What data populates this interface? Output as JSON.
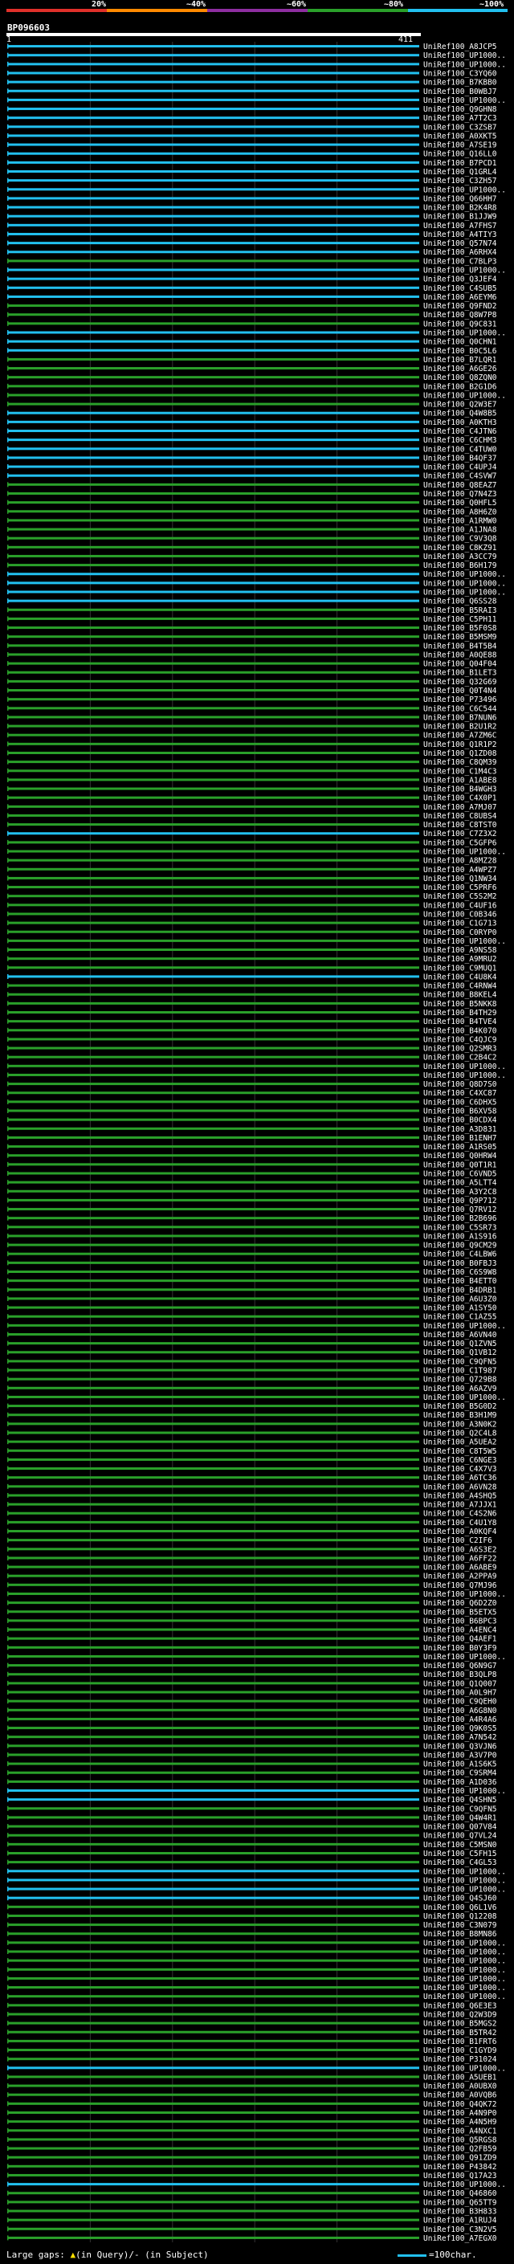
{
  "query_id": "BP096603",
  "query_length_start": "1",
  "query_length_end": "411",
  "scale_ticks": [
    "20%",
    "~40%",
    "~60%",
    "~80%",
    "~100%"
  ],
  "scale_colors": [
    "#e0302a",
    "#ff8a00",
    "#8e2ea0",
    "#2aa02a",
    "#22c0ef"
  ],
  "legend": {
    "left_text": "Large gaps: ",
    "gap_in_query": "(in Query)/",
    "gap_in_subject": "- (in Subject)",
    "right_text": "=100char."
  },
  "chart_data": {
    "type": "table",
    "title": "",
    "series_colors": {
      "high": "#22c0ef",
      "mid": "#2aa02a"
    },
    "rows": [
      {
        "id": "UniRef100_A8JCP5",
        "identity": "high"
      },
      {
        "id": "UniRef100_UP1000..",
        "identity": "high"
      },
      {
        "id": "UniRef100_UP1000..",
        "identity": "high"
      },
      {
        "id": "UniRef100_C3YQ60",
        "identity": "high"
      },
      {
        "id": "UniRef100_B7KBB0",
        "identity": "high"
      },
      {
        "id": "UniRef100_B0WBJ7",
        "identity": "high"
      },
      {
        "id": "UniRef100_UP1000..",
        "identity": "high"
      },
      {
        "id": "UniRef100_Q9GHN8",
        "identity": "high"
      },
      {
        "id": "UniRef100_A7T2C3",
        "identity": "high"
      },
      {
        "id": "UniRef100_C3ZSB7",
        "identity": "high"
      },
      {
        "id": "UniRef100_A0XKT5",
        "identity": "high"
      },
      {
        "id": "UniRef100_A7SE19",
        "identity": "high"
      },
      {
        "id": "UniRef100_Q16LL0",
        "identity": "high"
      },
      {
        "id": "UniRef100_B7PCD1",
        "identity": "high"
      },
      {
        "id": "UniRef100_Q1GRL4",
        "identity": "high"
      },
      {
        "id": "UniRef100_C3ZH57",
        "identity": "high"
      },
      {
        "id": "UniRef100_UP1000..",
        "identity": "high"
      },
      {
        "id": "UniRef100_Q66HH7",
        "identity": "high"
      },
      {
        "id": "UniRef100_B2K4R8",
        "identity": "high"
      },
      {
        "id": "UniRef100_B1JJW9",
        "identity": "high"
      },
      {
        "id": "UniRef100_A7FHS7",
        "identity": "high"
      },
      {
        "id": "UniRef100_A4TIY3",
        "identity": "high"
      },
      {
        "id": "UniRef100_Q57N74",
        "identity": "high"
      },
      {
        "id": "UniRef100_A6RHX4",
        "identity": "high"
      },
      {
        "id": "UniRef100_C7BLP3",
        "identity": "mid"
      },
      {
        "id": "UniRef100_UP1000..",
        "identity": "high"
      },
      {
        "id": "UniRef100_Q3JEF4",
        "identity": "high"
      },
      {
        "id": "UniRef100_C4SUB5",
        "identity": "high"
      },
      {
        "id": "UniRef100_A6EYM6",
        "identity": "high"
      },
      {
        "id": "UniRef100_Q9FND2",
        "identity": "mid"
      },
      {
        "id": "UniRef100_Q8W7P8",
        "identity": "mid"
      },
      {
        "id": "UniRef100_Q9C831",
        "identity": "mid"
      },
      {
        "id": "UniRef100_UP1000..",
        "identity": "high"
      },
      {
        "id": "UniRef100_Q0CHN1",
        "identity": "high"
      },
      {
        "id": "UniRef100_B0C5L6",
        "identity": "high"
      },
      {
        "id": "UniRef100_B7LQR1",
        "identity": "mid"
      },
      {
        "id": "UniRef100_A6GE26",
        "identity": "mid"
      },
      {
        "id": "UniRef100_Q8ZQN0",
        "identity": "mid"
      },
      {
        "id": "UniRef100_B2G1D6",
        "identity": "mid"
      },
      {
        "id": "UniRef100_UP1000..",
        "identity": "mid"
      },
      {
        "id": "UniRef100_Q2W3E7",
        "identity": "mid"
      },
      {
        "id": "UniRef100_Q4W8B5",
        "identity": "high"
      },
      {
        "id": "UniRef100_A0KTH3",
        "identity": "high"
      },
      {
        "id": "UniRef100_C4JTN6",
        "identity": "high"
      },
      {
        "id": "UniRef100_C6CHM3",
        "identity": "high"
      },
      {
        "id": "UniRef100_C4TUW0",
        "identity": "high"
      },
      {
        "id": "UniRef100_B4QF37",
        "identity": "high"
      },
      {
        "id": "UniRef100_C4UPJ4",
        "identity": "high"
      },
      {
        "id": "UniRef100_C4SVW7",
        "identity": "high"
      },
      {
        "id": "UniRef100_Q8EAZ7",
        "identity": "mid"
      },
      {
        "id": "UniRef100_Q7N4Z3",
        "identity": "mid"
      },
      {
        "id": "UniRef100_Q0HFL5",
        "identity": "mid"
      },
      {
        "id": "UniRef100_A8H6Z0",
        "identity": "mid"
      },
      {
        "id": "UniRef100_A1RMW0",
        "identity": "mid"
      },
      {
        "id": "UniRef100_A1JNA8",
        "identity": "mid"
      },
      {
        "id": "UniRef100_C9V3Q8",
        "identity": "mid"
      },
      {
        "id": "UniRef100_C8KZ91",
        "identity": "mid"
      },
      {
        "id": "UniRef100_A3CC79",
        "identity": "mid"
      },
      {
        "id": "UniRef100_B6H179",
        "identity": "mid"
      },
      {
        "id": "UniRef100_UP1000..",
        "identity": "high"
      },
      {
        "id": "UniRef100_UP1000..",
        "identity": "high"
      },
      {
        "id": "UniRef100_UP1000..",
        "identity": "high"
      },
      {
        "id": "UniRef100_Q6SS28",
        "identity": "high"
      },
      {
        "id": "UniRef100_B5RAI3",
        "identity": "mid"
      },
      {
        "id": "UniRef100_C5PH11",
        "identity": "mid"
      },
      {
        "id": "UniRef100_B5F0S8",
        "identity": "mid"
      },
      {
        "id": "UniRef100_B5MSM9",
        "identity": "mid"
      },
      {
        "id": "UniRef100_B4T5B4",
        "identity": "mid"
      },
      {
        "id": "UniRef100_A0QE88",
        "identity": "mid"
      },
      {
        "id": "UniRef100_Q04F04",
        "identity": "mid"
      },
      {
        "id": "UniRef100_B1LET3",
        "identity": "mid"
      },
      {
        "id": "UniRef100_Q32G69",
        "identity": "mid"
      },
      {
        "id": "UniRef100_Q0T4N4",
        "identity": "mid"
      },
      {
        "id": "UniRef100_P73496",
        "identity": "mid"
      },
      {
        "id": "UniRef100_C6C544",
        "identity": "mid"
      },
      {
        "id": "UniRef100_B7NUN6",
        "identity": "mid"
      },
      {
        "id": "UniRef100_B2U1R2",
        "identity": "mid"
      },
      {
        "id": "UniRef100_A7ZM6C",
        "identity": "mid"
      },
      {
        "id": "UniRef100_Q1R1P2",
        "identity": "mid"
      },
      {
        "id": "UniRef100_Q1ZD08",
        "identity": "mid"
      },
      {
        "id": "UniRef100_C8QM39",
        "identity": "mid"
      },
      {
        "id": "UniRef100_C1M4C3",
        "identity": "mid"
      },
      {
        "id": "UniRef100_A1ABE8",
        "identity": "mid"
      },
      {
        "id": "UniRef100_B4WGH3",
        "identity": "mid"
      },
      {
        "id": "UniRef100_C4X0P1",
        "identity": "mid"
      },
      {
        "id": "UniRef100_A7MJ07",
        "identity": "mid"
      },
      {
        "id": "UniRef100_C8UBS4",
        "identity": "mid"
      },
      {
        "id": "UniRef100_C8TST0",
        "identity": "mid"
      },
      {
        "id": "UniRef100_C7Z3X2",
        "identity": "high"
      },
      {
        "id": "UniRef100_C5GFP6",
        "identity": "mid"
      },
      {
        "id": "UniRef100_UP1000..",
        "identity": "mid"
      },
      {
        "id": "UniRef100_A8MZ28",
        "identity": "mid"
      },
      {
        "id": "UniRef100_A4WPZ7",
        "identity": "mid"
      },
      {
        "id": "UniRef100_Q1NW34",
        "identity": "mid"
      },
      {
        "id": "UniRef100_C5PRF6",
        "identity": "mid"
      },
      {
        "id": "UniRef100_C5S2M2",
        "identity": "mid"
      },
      {
        "id": "UniRef100_C4UF16",
        "identity": "mid"
      },
      {
        "id": "UniRef100_C0B346",
        "identity": "mid"
      },
      {
        "id": "UniRef100_C1G713",
        "identity": "mid"
      },
      {
        "id": "UniRef100_C0RYP0",
        "identity": "mid"
      },
      {
        "id": "UniRef100_UP1000..",
        "identity": "mid"
      },
      {
        "id": "UniRef100_A9NS58",
        "identity": "mid"
      },
      {
        "id": "UniRef100_A9MRU2",
        "identity": "mid"
      },
      {
        "id": "UniRef100_C9MUQ1",
        "identity": "mid"
      },
      {
        "id": "UniRef100_C4U8K4",
        "identity": "high"
      },
      {
        "id": "UniRef100_C4RNW4",
        "identity": "mid"
      },
      {
        "id": "UniRef100_B8KEL4",
        "identity": "mid"
      },
      {
        "id": "UniRef100_B5NKK8",
        "identity": "mid"
      },
      {
        "id": "UniRef100_B4TH29",
        "identity": "mid"
      },
      {
        "id": "UniRef100_B4TVE4",
        "identity": "mid"
      },
      {
        "id": "UniRef100_B4K070",
        "identity": "mid"
      },
      {
        "id": "UniRef100_C4QJC9",
        "identity": "mid"
      },
      {
        "id": "UniRef100_Q2SMR3",
        "identity": "mid"
      },
      {
        "id": "UniRef100_C2B4C2",
        "identity": "mid"
      },
      {
        "id": "UniRef100_UP1000..",
        "identity": "mid"
      },
      {
        "id": "UniRef100_UP1000..",
        "identity": "mid"
      },
      {
        "id": "UniRef100_Q8D7S0",
        "identity": "mid"
      },
      {
        "id": "UniRef100_C4XC87",
        "identity": "mid"
      },
      {
        "id": "UniRef100_C6DHX5",
        "identity": "mid"
      },
      {
        "id": "UniRef100_B6XV58",
        "identity": "mid"
      },
      {
        "id": "UniRef100_B0CDX4",
        "identity": "mid"
      },
      {
        "id": "UniRef100_A3D831",
        "identity": "mid"
      },
      {
        "id": "UniRef100_B1ENH7",
        "identity": "mid"
      },
      {
        "id": "UniRef100_A1RS05",
        "identity": "mid"
      },
      {
        "id": "UniRef100_Q0HRW4",
        "identity": "mid"
      },
      {
        "id": "UniRef100_Q0T1R1",
        "identity": "mid"
      },
      {
        "id": "UniRef100_C6VND5",
        "identity": "mid"
      },
      {
        "id": "UniRef100_A5LTT4",
        "identity": "mid"
      },
      {
        "id": "UniRef100_A3Y2C8",
        "identity": "mid"
      },
      {
        "id": "UniRef100_Q9P712",
        "identity": "mid"
      },
      {
        "id": "UniRef100_Q7RV12",
        "identity": "mid"
      },
      {
        "id": "UniRef100_B2B696",
        "identity": "mid"
      },
      {
        "id": "UniRef100_C5SR73",
        "identity": "mid"
      },
      {
        "id": "UniRef100_A1S916",
        "identity": "mid"
      },
      {
        "id": "UniRef100_Q9CM29",
        "identity": "mid"
      },
      {
        "id": "UniRef100_C4LBW6",
        "identity": "mid"
      },
      {
        "id": "UniRef100_B0FBJ3",
        "identity": "mid"
      },
      {
        "id": "UniRef100_C6S9W8",
        "identity": "mid"
      },
      {
        "id": "UniRef100_B4ETT0",
        "identity": "mid"
      },
      {
        "id": "UniRef100_B4DRB1",
        "identity": "mid"
      },
      {
        "id": "UniRef100_A6U3Z0",
        "identity": "mid"
      },
      {
        "id": "UniRef100_A1SY50",
        "identity": "mid"
      },
      {
        "id": "UniRef100_C1AZ55",
        "identity": "mid"
      },
      {
        "id": "UniRef100_UP1000..",
        "identity": "mid"
      },
      {
        "id": "UniRef100_A6VN40",
        "identity": "mid"
      },
      {
        "id": "UniRef100_Q1ZVN5",
        "identity": "mid"
      },
      {
        "id": "UniRef100_Q1VB12",
        "identity": "mid"
      },
      {
        "id": "UniRef100_C9QFN5",
        "identity": "mid"
      },
      {
        "id": "UniRef100_C1T987",
        "identity": "mid"
      },
      {
        "id": "UniRef100_Q729B8",
        "identity": "mid"
      },
      {
        "id": "UniRef100_A6AZV9",
        "identity": "mid"
      },
      {
        "id": "UniRef100_UP1000..",
        "identity": "mid"
      },
      {
        "id": "UniRef100_B5G0D2",
        "identity": "mid"
      },
      {
        "id": "UniRef100_B3H1M9",
        "identity": "mid"
      },
      {
        "id": "UniRef100_A3N0K2",
        "identity": "mid"
      },
      {
        "id": "UniRef100_Q2C4L8",
        "identity": "mid"
      },
      {
        "id": "UniRef100_A5UEA2",
        "identity": "mid"
      },
      {
        "id": "UniRef100_C8T5W5",
        "identity": "mid"
      },
      {
        "id": "UniRef100_C6NGE3",
        "identity": "mid"
      },
      {
        "id": "UniRef100_C4X7V3",
        "identity": "mid"
      },
      {
        "id": "UniRef100_A6TC36",
        "identity": "mid"
      },
      {
        "id": "UniRef100_A6VN28",
        "identity": "mid"
      },
      {
        "id": "UniRef100_A4SHQ5",
        "identity": "mid"
      },
      {
        "id": "UniRef100_A7JJX1",
        "identity": "mid"
      },
      {
        "id": "UniRef100_C4S2N6",
        "identity": "mid"
      },
      {
        "id": "UniRef100_C4U1Y8",
        "identity": "mid"
      },
      {
        "id": "UniRef100_A0KQF4",
        "identity": "mid"
      },
      {
        "id": "UniRef100_C2IF6",
        "identity": "mid"
      },
      {
        "id": "UniRef100_A6S3E2",
        "identity": "mid"
      },
      {
        "id": "UniRef100_A6FF22",
        "identity": "mid"
      },
      {
        "id": "UniRef100_A6ABE9",
        "identity": "mid"
      },
      {
        "id": "UniRef100_A2PPA9",
        "identity": "mid"
      },
      {
        "id": "UniRef100_Q7MJ96",
        "identity": "mid"
      },
      {
        "id": "UniRef100_UP1000..",
        "identity": "mid"
      },
      {
        "id": "UniRef100_Q6D2Z0",
        "identity": "mid"
      },
      {
        "id": "UniRef100_B5ETX5",
        "identity": "mid"
      },
      {
        "id": "UniRef100_B6BPC3",
        "identity": "mid"
      },
      {
        "id": "UniRef100_A4ENC4",
        "identity": "mid"
      },
      {
        "id": "UniRef100_Q4AEF1",
        "identity": "mid"
      },
      {
        "id": "UniRef100_B0Y3F9",
        "identity": "mid"
      },
      {
        "id": "UniRef100_UP1000..",
        "identity": "mid"
      },
      {
        "id": "UniRef100_Q6N9G7",
        "identity": "mid"
      },
      {
        "id": "UniRef100_B3QLP8",
        "identity": "mid"
      },
      {
        "id": "UniRef100_Q1Q007",
        "identity": "mid"
      },
      {
        "id": "UniRef100_A0L9H7",
        "identity": "mid"
      },
      {
        "id": "UniRef100_C9QEH0",
        "identity": "mid"
      },
      {
        "id": "UniRef100_A6G8N0",
        "identity": "mid"
      },
      {
        "id": "UniRef100_A4R4A6",
        "identity": "mid"
      },
      {
        "id": "UniRef100_Q9K0S5",
        "identity": "mid"
      },
      {
        "id": "UniRef100_A7N542",
        "identity": "mid"
      },
      {
        "id": "UniRef100_Q3VJN6",
        "identity": "mid"
      },
      {
        "id": "UniRef100_A3V7P0",
        "identity": "mid"
      },
      {
        "id": "UniRef100_A1S6K5",
        "identity": "mid"
      },
      {
        "id": "UniRef100_C9SRM4",
        "identity": "mid"
      },
      {
        "id": "UniRef100_A1D036",
        "identity": "mid"
      },
      {
        "id": "UniRef100_UP1000..",
        "identity": "high"
      },
      {
        "id": "UniRef100_Q4SHN5",
        "identity": "high"
      },
      {
        "id": "UniRef100_C9QFN5",
        "identity": "mid"
      },
      {
        "id": "UniRef100_Q4W4R1",
        "identity": "mid"
      },
      {
        "id": "UniRef100_Q07V84",
        "identity": "mid"
      },
      {
        "id": "UniRef100_Q7VL24",
        "identity": "mid"
      },
      {
        "id": "UniRef100_C5MSN0",
        "identity": "mid"
      },
      {
        "id": "UniRef100_C5FH15",
        "identity": "mid"
      },
      {
        "id": "UniRef100_C4GL53",
        "identity": "mid"
      },
      {
        "id": "UniRef100_UP1000..",
        "identity": "high"
      },
      {
        "id": "UniRef100_UP1000..",
        "identity": "high"
      },
      {
        "id": "UniRef100_UP1000..",
        "identity": "high"
      },
      {
        "id": "UniRef100_Q4SJ60",
        "identity": "high"
      },
      {
        "id": "UniRef100_Q6L1V6",
        "identity": "mid"
      },
      {
        "id": "UniRef100_Q12208",
        "identity": "mid"
      },
      {
        "id": "UniRef100_C3N079",
        "identity": "mid"
      },
      {
        "id": "UniRef100_B8MN86",
        "identity": "mid"
      },
      {
        "id": "UniRef100_UP1000..",
        "identity": "mid"
      },
      {
        "id": "UniRef100_UP1000..",
        "identity": "mid"
      },
      {
        "id": "UniRef100_UP1000..",
        "identity": "mid"
      },
      {
        "id": "UniRef100_UP1000..",
        "identity": "mid"
      },
      {
        "id": "UniRef100_UP1000..",
        "identity": "mid"
      },
      {
        "id": "UniRef100_UP1000..",
        "identity": "mid"
      },
      {
        "id": "UniRef100_UP1000..",
        "identity": "mid"
      },
      {
        "id": "UniRef100_Q6E3E3",
        "identity": "mid"
      },
      {
        "id": "UniRef100_Q2W3D9",
        "identity": "mid"
      },
      {
        "id": "UniRef100_B5MGS2",
        "identity": "mid"
      },
      {
        "id": "UniRef100_B5TR42",
        "identity": "mid"
      },
      {
        "id": "UniRef100_B1FRT6",
        "identity": "mid"
      },
      {
        "id": "UniRef100_C1GYD9",
        "identity": "mid"
      },
      {
        "id": "UniRef100_P31024",
        "identity": "mid"
      },
      {
        "id": "UniRef100_UP1000..",
        "identity": "high"
      },
      {
        "id": "UniRef100_A5UEB1",
        "identity": "mid"
      },
      {
        "id": "UniRef100_A0UBX0",
        "identity": "mid"
      },
      {
        "id": "UniRef100_A0VQB6",
        "identity": "mid"
      },
      {
        "id": "UniRef100_Q4QK72",
        "identity": "mid"
      },
      {
        "id": "UniRef100_A4N9P0",
        "identity": "mid"
      },
      {
        "id": "UniRef100_A4N5H9",
        "identity": "mid"
      },
      {
        "id": "UniRef100_A4NXC1",
        "identity": "mid"
      },
      {
        "id": "UniRef100_Q5RGS8",
        "identity": "mid"
      },
      {
        "id": "UniRef100_Q2FB59",
        "identity": "mid"
      },
      {
        "id": "UniRef100_Q91ZD9",
        "identity": "mid"
      },
      {
        "id": "UniRef100_P43842",
        "identity": "mid"
      },
      {
        "id": "UniRef100_Q17A23",
        "identity": "mid"
      },
      {
        "id": "UniRef100_UP1000..",
        "identity": "high"
      },
      {
        "id": "UniRef100_Q46860",
        "identity": "mid"
      },
      {
        "id": "UniRef100_Q65TT9",
        "identity": "mid"
      },
      {
        "id": "UniRef100_B3H833",
        "identity": "mid"
      },
      {
        "id": "UniRef100_A1RUJ4",
        "identity": "mid"
      },
      {
        "id": "UniRef100_C3N2V5",
        "identity": "mid"
      },
      {
        "id": "UniRef100_A7EGX0",
        "identity": "mid"
      }
    ]
  }
}
